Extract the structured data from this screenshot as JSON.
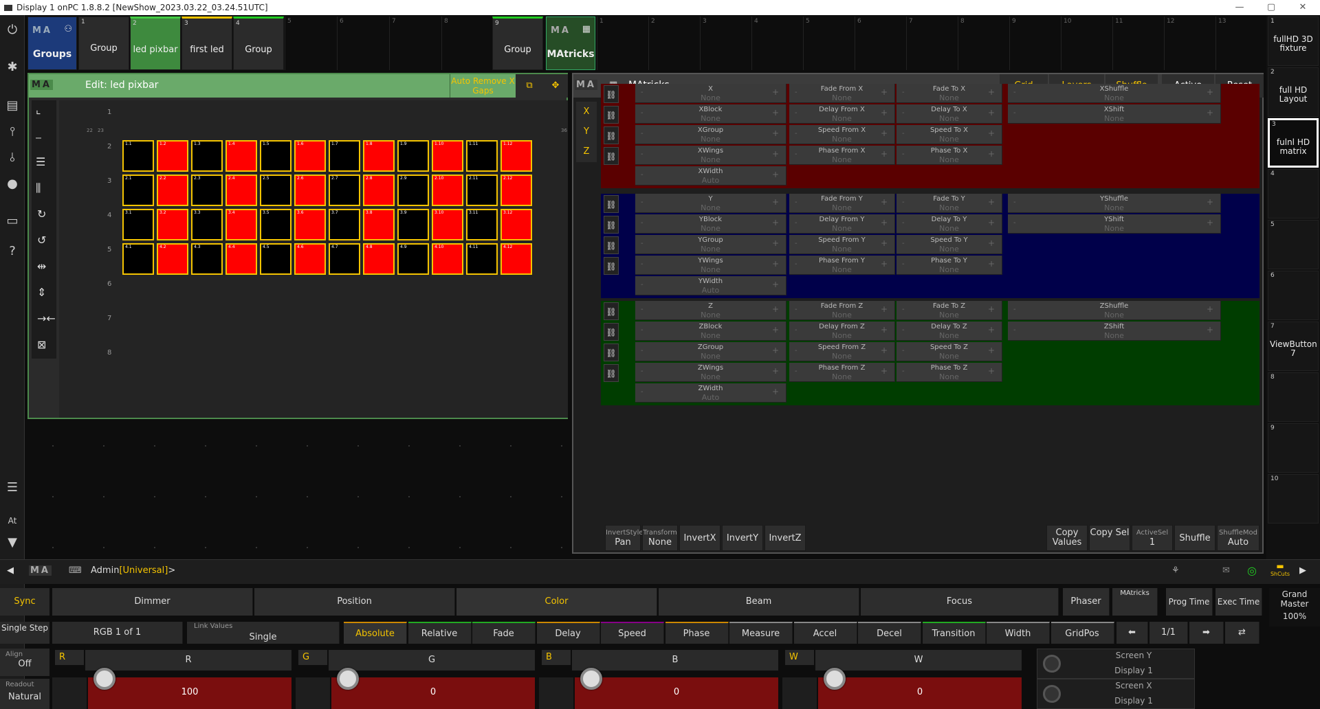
{
  "window": {
    "title": "Display 1 onPC 1.8.8.2 [NewShow_2023.03.22_03.24.51UTC]",
    "min": "—",
    "max": "▢",
    "close": "✕"
  },
  "pool": {
    "label": "Groups",
    "items": [
      {
        "n": "1",
        "t": "Group"
      },
      {
        "n": "2",
        "t": "led pixbar"
      },
      {
        "n": "3",
        "t": "first led"
      },
      {
        "n": "4",
        "t": "Group"
      }
    ],
    "empty": [
      "5",
      "6",
      "7",
      "8"
    ],
    "item9": {
      "n": "9",
      "t": "Group"
    },
    "plugin": "MAtricks",
    "empty2": [
      "1",
      "2",
      "3",
      "4",
      "5",
      "6",
      "7",
      "8",
      "9",
      "10",
      "11",
      "12",
      "13"
    ]
  },
  "edit": {
    "title": "Edit: led pixbar",
    "auto": "Auto Remove X Gaps",
    "row_nums": [
      "1",
      "2",
      "3",
      "4",
      "5",
      "6",
      "7",
      "8"
    ],
    "col_nums": [
      "22",
      "23",
      "36"
    ]
  },
  "cells": [
    [
      "1.1",
      "1.2",
      "1.3",
      "1.4",
      "1.5",
      "1.6",
      "1.7",
      "1.8",
      "1.9",
      "1.10",
      "1.11",
      "1.12"
    ],
    [
      "2.1",
      "2.2",
      "2.3",
      "2.4",
      "2.5",
      "2.6",
      "2.7",
      "2.8",
      "2.9",
      "2.10",
      "2.11",
      "2.12"
    ],
    [
      "3.1",
      "3.2",
      "3.3",
      "3.4",
      "3.5",
      "3.6",
      "3.7",
      "3.8",
      "3.9",
      "3.10",
      "3.11",
      "3.12"
    ],
    [
      "4.1",
      "4.2",
      "4.3",
      "4.4",
      "4.5",
      "4.6",
      "4.7",
      "4.8",
      "4.9",
      "4.10",
      "4.11",
      "4.12"
    ]
  ],
  "matricks": {
    "title": "MAtricks",
    "tabs": [
      "Grid",
      "Layers",
      "Shuffle",
      "Active",
      "Reset"
    ],
    "axes": [
      "X",
      "Y",
      "Z"
    ],
    "x": {
      "main": [
        [
          "X",
          "None"
        ],
        [
          "XBlock",
          "None"
        ],
        [
          "XGroup",
          "None"
        ],
        [
          "XWings",
          "None"
        ],
        [
          "XWidth",
          "Auto"
        ]
      ],
      "mid": [
        [
          "Fade From X",
          "None"
        ],
        [
          "Delay From X",
          "None"
        ],
        [
          "Speed From X",
          "None"
        ],
        [
          "Phase From X",
          "None"
        ]
      ],
      "to": [
        [
          "Fade To X",
          "None"
        ],
        [
          "Delay To X",
          "None"
        ],
        [
          "Speed To X",
          "None"
        ],
        [
          "Phase To X",
          "None"
        ]
      ],
      "sh": [
        [
          "XShuffle",
          "None"
        ],
        [
          "XShift",
          "None"
        ]
      ]
    },
    "y": {
      "main": [
        [
          "Y",
          "None"
        ],
        [
          "YBlock",
          "None"
        ],
        [
          "YGroup",
          "None"
        ],
        [
          "YWings",
          "None"
        ],
        [
          "YWidth",
          "Auto"
        ]
      ],
      "mid": [
        [
          "Fade From Y",
          "None"
        ],
        [
          "Delay From Y",
          "None"
        ],
        [
          "Speed From Y",
          "None"
        ],
        [
          "Phase From Y",
          "None"
        ]
      ],
      "to": [
        [
          "Fade To Y",
          "None"
        ],
        [
          "Delay To Y",
          "None"
        ],
        [
          "Speed To Y",
          "None"
        ],
        [
          "Phase To Y",
          "None"
        ]
      ],
      "sh": [
        [
          "YShuffle",
          "None"
        ],
        [
          "YShift",
          "None"
        ]
      ]
    },
    "z": {
      "main": [
        [
          "Z",
          "None"
        ],
        [
          "ZBlock",
          "None"
        ],
        [
          "ZGroup",
          "None"
        ],
        [
          "ZWings",
          "None"
        ],
        [
          "ZWidth",
          "Auto"
        ]
      ],
      "mid": [
        [
          "Fade From Z",
          "None"
        ],
        [
          "Delay From Z",
          "None"
        ],
        [
          "Speed From Z",
          "None"
        ],
        [
          "Phase From Z",
          "None"
        ]
      ],
      "to": [
        [
          "Fade To Z",
          "None"
        ],
        [
          "Delay To Z",
          "None"
        ],
        [
          "Speed To Z",
          "None"
        ],
        [
          "Phase To Z",
          "None"
        ]
      ],
      "sh": [
        [
          "ZShuffle",
          "None"
        ],
        [
          "ZShift",
          "None"
        ]
      ]
    },
    "bottom": {
      "invert_style_lbl": "InvertStyle",
      "invert_style": "Pan",
      "transform_lbl": "Transform",
      "transform": "None",
      "invx": "InvertX",
      "invy": "InvertY",
      "invz": "InvertZ",
      "copy_values": "Copy Values",
      "copy_sel": "Copy Sel",
      "activesel_lbl": "ActiveSel",
      "activesel": "1",
      "shuffle": "Shuffle",
      "shufflemode_lbl": "ShuffleMod",
      "shufflemode": "Auto"
    },
    "minus": "-",
    "plus": "+"
  },
  "right": [
    {
      "n": "1",
      "t": "fullHD 3D fixture"
    },
    {
      "n": "2",
      "t": "full HD Layout"
    },
    {
      "n": "3",
      "t": "fulnl HD matrix"
    },
    {
      "n": "4",
      "t": ""
    },
    {
      "n": "5",
      "t": ""
    },
    {
      "n": "6",
      "t": ""
    },
    {
      "n": "7",
      "t": "ViewButton 7"
    },
    {
      "n": "8",
      "t": ""
    },
    {
      "n": "9",
      "t": ""
    },
    {
      "n": "10",
      "t": ""
    }
  ],
  "cmd": {
    "prompt_user": "Admin",
    "prompt_env": "[Universal]",
    "prompt_end": ">",
    "shcuts": "ShCuts"
  },
  "features": {
    "sync": "Sync",
    "items": [
      "Dimmer",
      "Position",
      "Color",
      "Beam",
      "Focus"
    ],
    "phaser": "Phaser",
    "matricks": "MAtricks",
    "prog_time": "Prog Time",
    "exec_time": "Exec Time",
    "grand": "Grand Master",
    "grand_val": "100%"
  },
  "presets": {
    "step": "Single Step",
    "rgb": "RGB 1 of 1",
    "link_lbl": "Link Values",
    "link": "Single",
    "items": [
      "Absolute",
      "Relative",
      "Fade",
      "Delay",
      "Speed",
      "Phase",
      "Measure",
      "Accel",
      "Decel",
      "Transition",
      "Width",
      "GridPos"
    ],
    "page": "1/1"
  },
  "encoders": {
    "align_lbl": "Align",
    "align": "Off",
    "readout_lbl": "Readout",
    "readout": "Natural",
    "ch": [
      {
        "k": "R",
        "t": "R",
        "v": "100"
      },
      {
        "k": "G",
        "t": "G",
        "v": "0"
      },
      {
        "k": "B",
        "t": "B",
        "v": "0"
      },
      {
        "k": "W",
        "t": "W",
        "v": "0"
      }
    ],
    "screens": [
      {
        "t": "Screen Y",
        "d": "Display 1"
      },
      {
        "t": "Screen X",
        "d": "Display 1"
      }
    ]
  },
  "colors": {
    "red": "#ff0000",
    "yellow": "#f5c400",
    "green_header": "#5ea35e",
    "x_bg": "#5a0000",
    "y_bg": "#00004a",
    "z_bg": "#003d00"
  }
}
